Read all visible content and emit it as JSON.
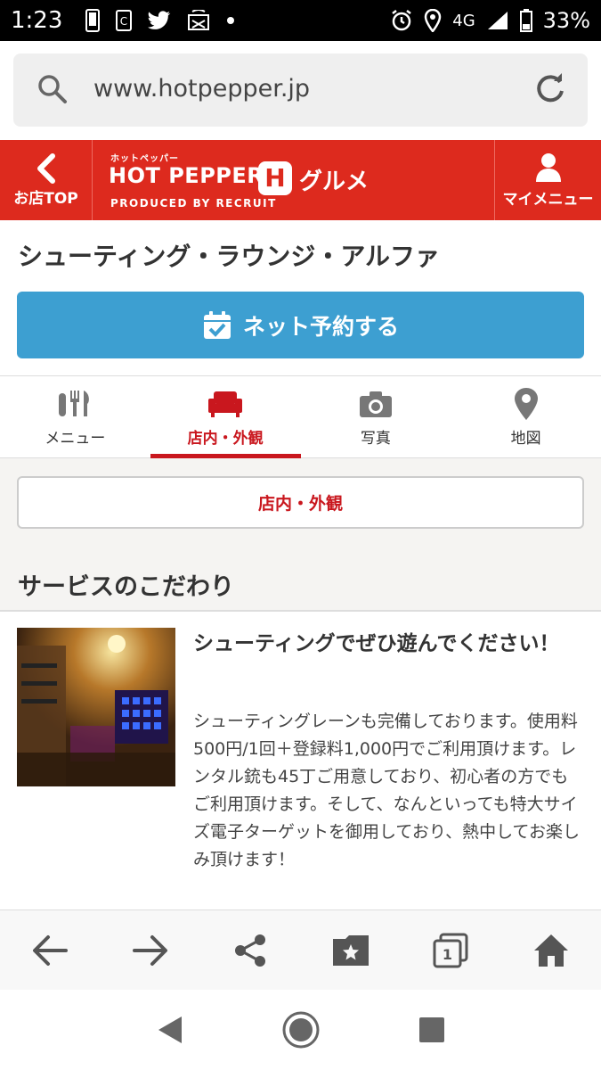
{
  "status_bar": {
    "time": "1:23",
    "network": "4G",
    "battery": "33%"
  },
  "browser": {
    "url": "www.hotpepper.jp"
  },
  "header": {
    "back_label": "お店TOP",
    "logo_small": "ホットペッパー",
    "logo_main": "HOT PEPPER",
    "logo_h": "H",
    "logo_gourmet": "グルメ",
    "logo_produced": "PRODUCED BY RECRUIT",
    "mymenu_label": "マイメニュー",
    "brand_color": "#dd2a1e"
  },
  "shop": {
    "name": "シューティング・ラウンジ・アルファ"
  },
  "reserve": {
    "label": "ネット予約する",
    "color": "#3d9fd1"
  },
  "tabs": [
    {
      "label": "メニュー",
      "icon": "cutlery-icon",
      "active": false
    },
    {
      "label": "店内・外観",
      "icon": "sofa-icon",
      "active": true
    },
    {
      "label": "写真",
      "icon": "camera-icon",
      "active": false
    },
    {
      "label": "地図",
      "icon": "map-pin-icon",
      "active": false
    }
  ],
  "content": {
    "sub_button": "店内・外観",
    "section_title": "サービスのこだわり",
    "service": {
      "heading": "シューティングでぜひ遊んでください！",
      "body": "シューティングレーンも完備しております。使用料500円/1回＋登録料1,000円でご利用頂けます。レンタル銃も45丁ご用意しており、初心者の方でもご利用頂けます。そして、なんといっても特大サイズ電子ターゲットを御用しており、熱中してお楽しみ頂けます！"
    }
  },
  "browser_toolbar": {
    "tab_count": "1"
  }
}
